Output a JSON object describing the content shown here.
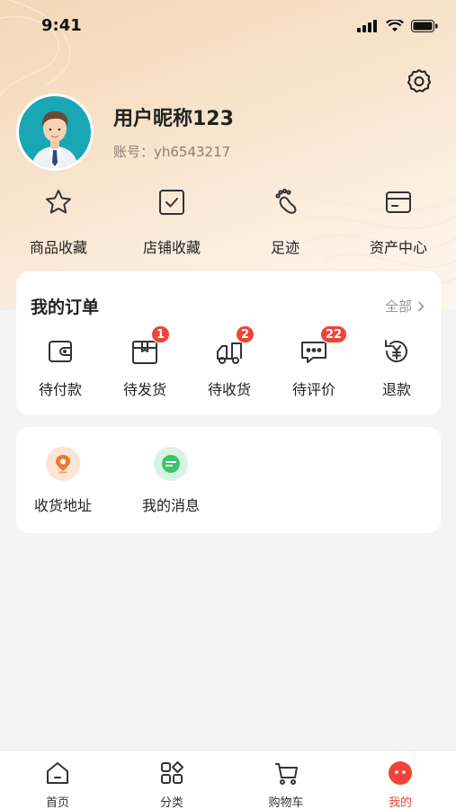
{
  "status_bar": {
    "time": "9:41"
  },
  "profile": {
    "nickname": "用户昵称123",
    "account": "账号：yh6543217"
  },
  "quick_actions": [
    {
      "label": "商品收藏",
      "icon": "star-icon"
    },
    {
      "label": "店铺收藏",
      "icon": "checkbox-icon"
    },
    {
      "label": "足迹",
      "icon": "footprint-icon"
    },
    {
      "label": "资产中心",
      "icon": "wallet-card-icon"
    }
  ],
  "orders": {
    "title": "我的订单",
    "view_all": "全部",
    "items": [
      {
        "label": "待付款",
        "icon": "wallet-icon",
        "badge": null
      },
      {
        "label": "待发货",
        "icon": "package-icon",
        "badge": "1"
      },
      {
        "label": "待收货",
        "icon": "truck-icon",
        "badge": "2"
      },
      {
        "label": "待评价",
        "icon": "comment-icon",
        "badge": "22"
      },
      {
        "label": "退款",
        "icon": "refund-icon",
        "badge": null
      }
    ]
  },
  "services": [
    {
      "label": "收货地址",
      "icon": "location-pin-icon",
      "color": "#f07a2c"
    },
    {
      "label": "我的消息",
      "icon": "message-icon",
      "color": "#3cc36b"
    }
  ],
  "tabbar": [
    {
      "label": "首页",
      "icon": "home-icon",
      "active": false
    },
    {
      "label": "分类",
      "icon": "category-icon",
      "active": false
    },
    {
      "label": "购物车",
      "icon": "cart-icon",
      "active": false
    },
    {
      "label": "我的",
      "icon": "profile-face-icon",
      "active": true
    }
  ],
  "colors": {
    "accent": "#f0443a",
    "hero_gradient_start": "#f3d7b6",
    "hero_gradient_end": "#fdf6ee"
  }
}
